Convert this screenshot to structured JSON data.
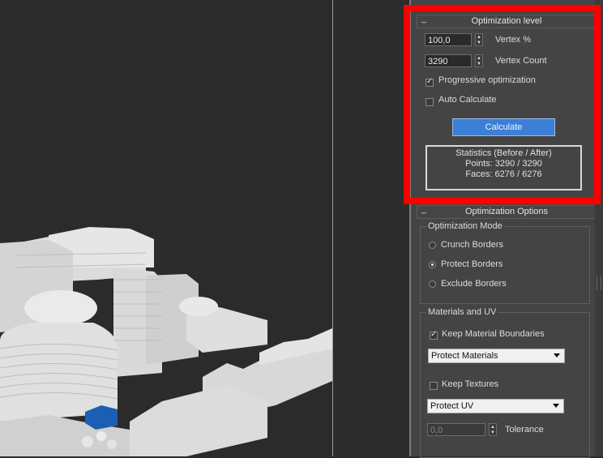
{
  "optimization_level": {
    "title": "Optimization level",
    "collapse": "_",
    "vertex_percent": {
      "value": "100,0",
      "label": "Vertex %"
    },
    "vertex_count": {
      "value": "3290",
      "label": "Vertex Count"
    },
    "progressive": {
      "label": "Progressive optimization",
      "checked": true
    },
    "auto_calculate": {
      "label": "Auto Calculate",
      "checked": false
    },
    "calculate_button": "Calculate",
    "stats": {
      "heading": "Statistics (Before / After)",
      "points": "Points: 3290 / 3290",
      "faces": "Faces: 6276 / 6276"
    }
  },
  "optimization_options": {
    "title": "Optimization Options",
    "collapse": "_",
    "mode_group": "Optimization Mode",
    "modes": [
      {
        "label": "Crunch Borders",
        "selected": false
      },
      {
        "label": "Protect Borders",
        "selected": true
      },
      {
        "label": "Exclude Borders",
        "selected": false
      }
    ],
    "materials_group": "Materials and UV",
    "keep_material_boundaries": {
      "label": "Keep Material Boundaries",
      "checked": true
    },
    "materials_dropdown": "Protect Materials",
    "keep_textures": {
      "label": "Keep Textures",
      "checked": false
    },
    "uv_dropdown": "Protect UV",
    "tolerance": {
      "value": "0,0",
      "label": "Tolerance"
    }
  },
  "colors": {
    "highlight": "#ff0000",
    "calculate": "#3b7fd6",
    "selected_object": "#1a5fb4"
  }
}
